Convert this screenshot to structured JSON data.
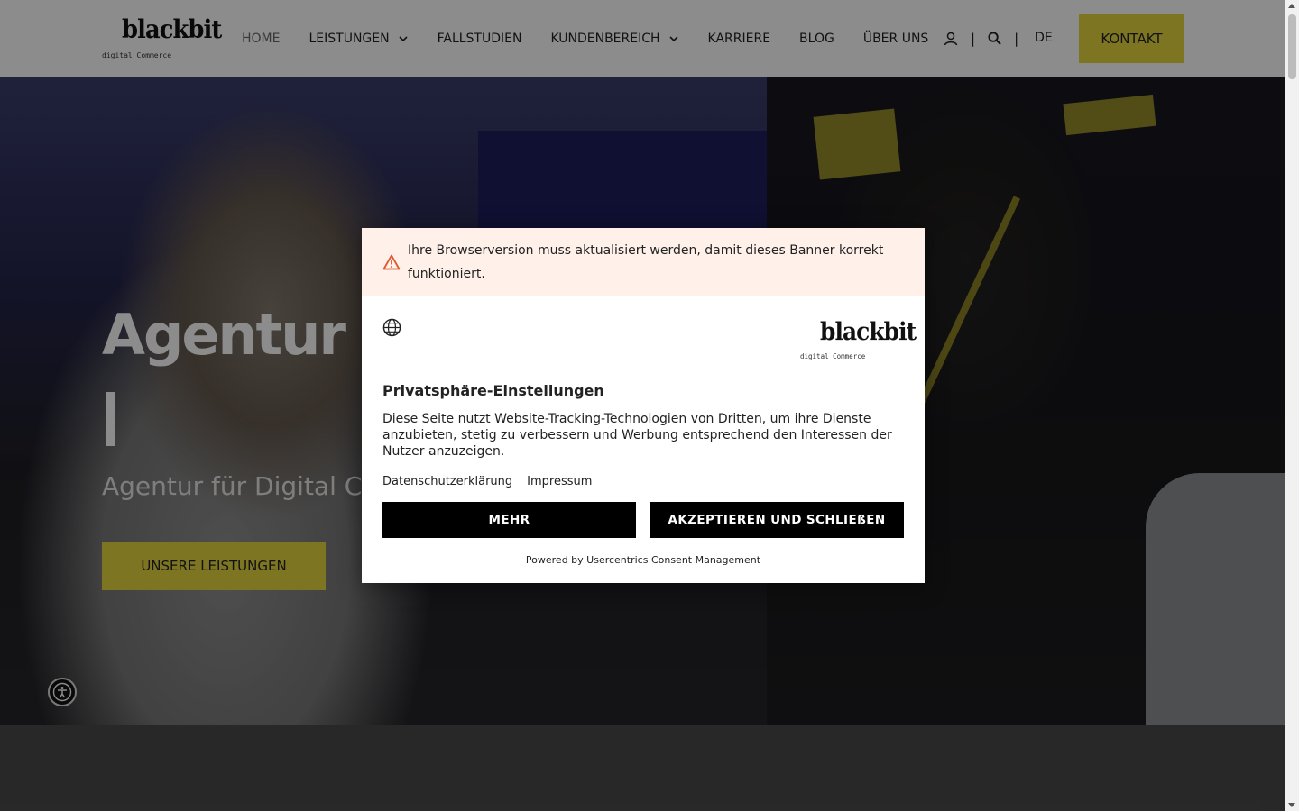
{
  "header": {
    "logo_text": "blackbit",
    "logo_sub": "digital Commerce",
    "nav": [
      {
        "label": "HOME",
        "dropdown": false,
        "active": true
      },
      {
        "label": "LEISTUNGEN",
        "dropdown": true,
        "active": false
      },
      {
        "label": "FALLSTUDIEN",
        "dropdown": false,
        "active": false
      },
      {
        "label": "KUNDENBEREICH",
        "dropdown": true,
        "active": false
      },
      {
        "label": "KARRIERE",
        "dropdown": false,
        "active": false
      },
      {
        "label": "BLOG",
        "dropdown": false,
        "active": false
      },
      {
        "label": "ÜBER UNS",
        "dropdown": false,
        "active": false
      }
    ],
    "separator": "|",
    "language": "DE",
    "contact_label": "KONTAKT",
    "icons": [
      "user-icon",
      "search-icon"
    ]
  },
  "hero": {
    "title": "Agentur",
    "subtitle": "Agentur für Digital Com",
    "cta_label": "UNSERE LEISTUNGEN"
  },
  "consent": {
    "warning_text": "Ihre Browserversion muss aktualisiert werden, damit dieses Banner korrekt funktioniert.",
    "logo_text": "blackbit",
    "logo_sub": "digital Commerce",
    "title": "Privatsphäre-Einstellungen",
    "description": "Diese Seite nutzt Website-Tracking-Technologien von Dritten, um ihre Dienste anzubieten, stetig zu verbessern und Werbung entsprechend den Interessen der Nutzer anzuzeigen.",
    "links": [
      "Datenschutzerklärung",
      "Impressum"
    ],
    "more_label": "MEHR",
    "accept_label": "AKZEPTIEREN UND SCHLIEßEN",
    "powered_by": "Powered by Usercentrics Consent Management"
  },
  "colors": {
    "accent": "#e6d63f",
    "warning_bg": "#fff1ea",
    "warning_icon": "#e0582a",
    "button_dark": "#000000"
  }
}
